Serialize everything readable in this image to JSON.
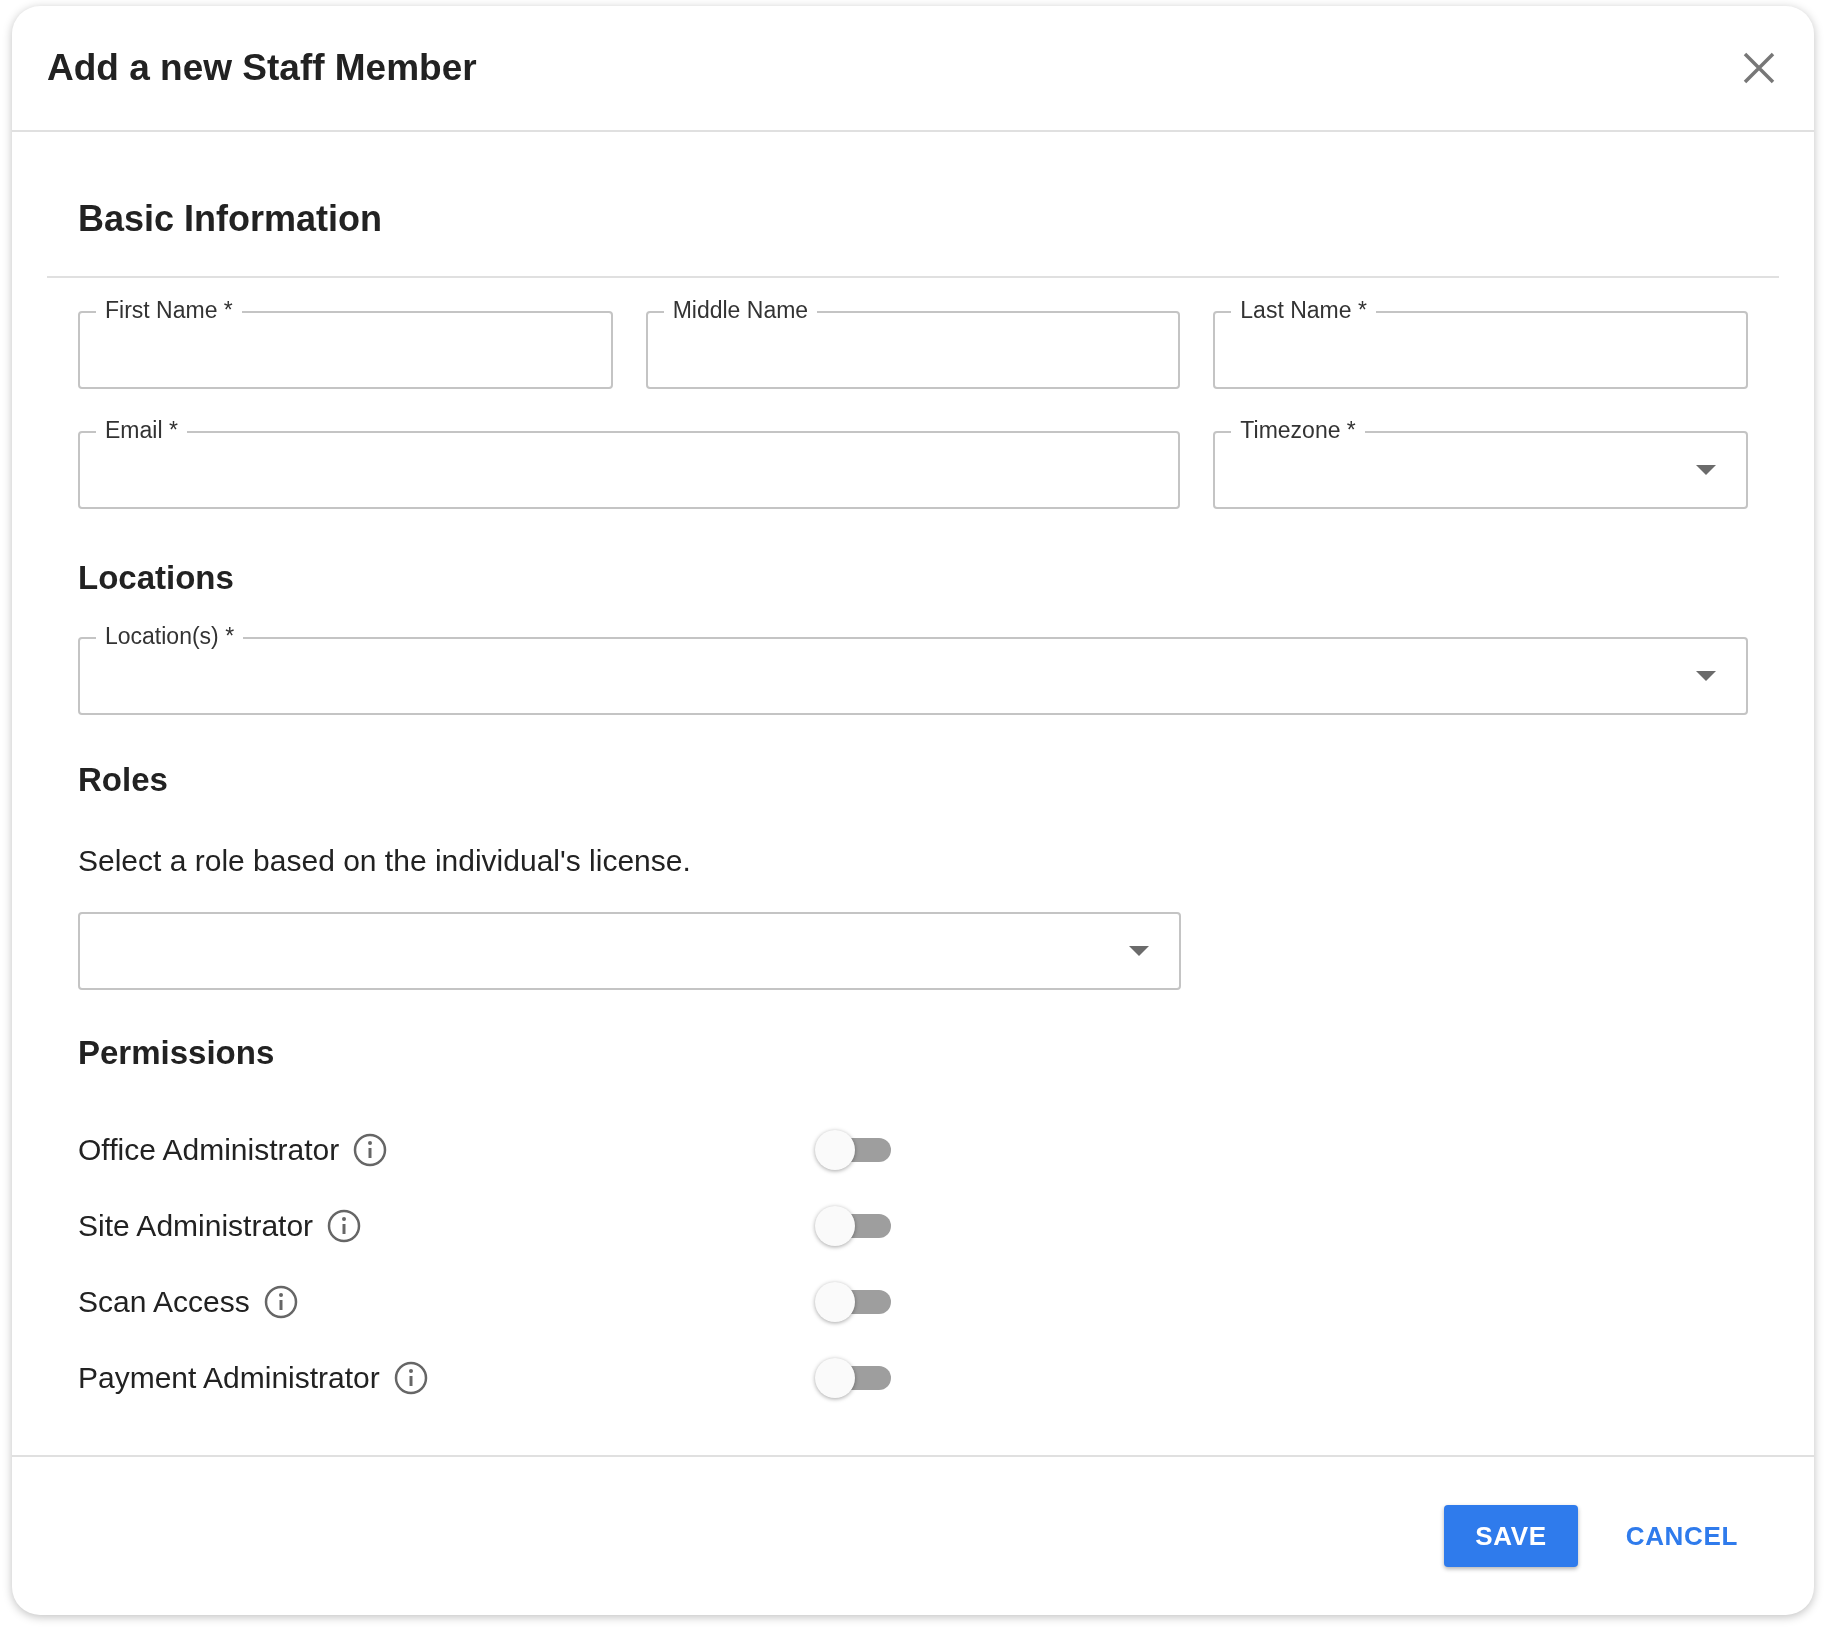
{
  "dialog": {
    "title": "Add a new Staff Member"
  },
  "basic_information": {
    "heading": "Basic Information",
    "first_name": {
      "label": "First Name *",
      "kind": "text"
    },
    "middle_name": {
      "label": "Middle Name",
      "kind": "text"
    },
    "last_name": {
      "label": "Last Name *",
      "kind": "text"
    },
    "email": {
      "label": "Email *",
      "kind": "text"
    },
    "timezone": {
      "label": "Timezone *",
      "kind": "select"
    }
  },
  "locations": {
    "heading": "Locations",
    "field": {
      "label": "Location(s) *",
      "kind": "select"
    }
  },
  "roles": {
    "heading": "Roles",
    "description": "Select a role based on the individual's license.",
    "field": {
      "kind": "select"
    }
  },
  "permissions": {
    "heading": "Permissions",
    "items": [
      {
        "label": "Office Administrator",
        "on": false
      },
      {
        "label": "Site Administrator",
        "on": false
      },
      {
        "label": "Scan Access",
        "on": false
      },
      {
        "label": "Payment Administrator",
        "on": false
      }
    ]
  },
  "buttons": [
    {
      "label": "SAVE",
      "kind": "primary"
    },
    {
      "label": "CANCEL",
      "kind": "text"
    }
  ]
}
